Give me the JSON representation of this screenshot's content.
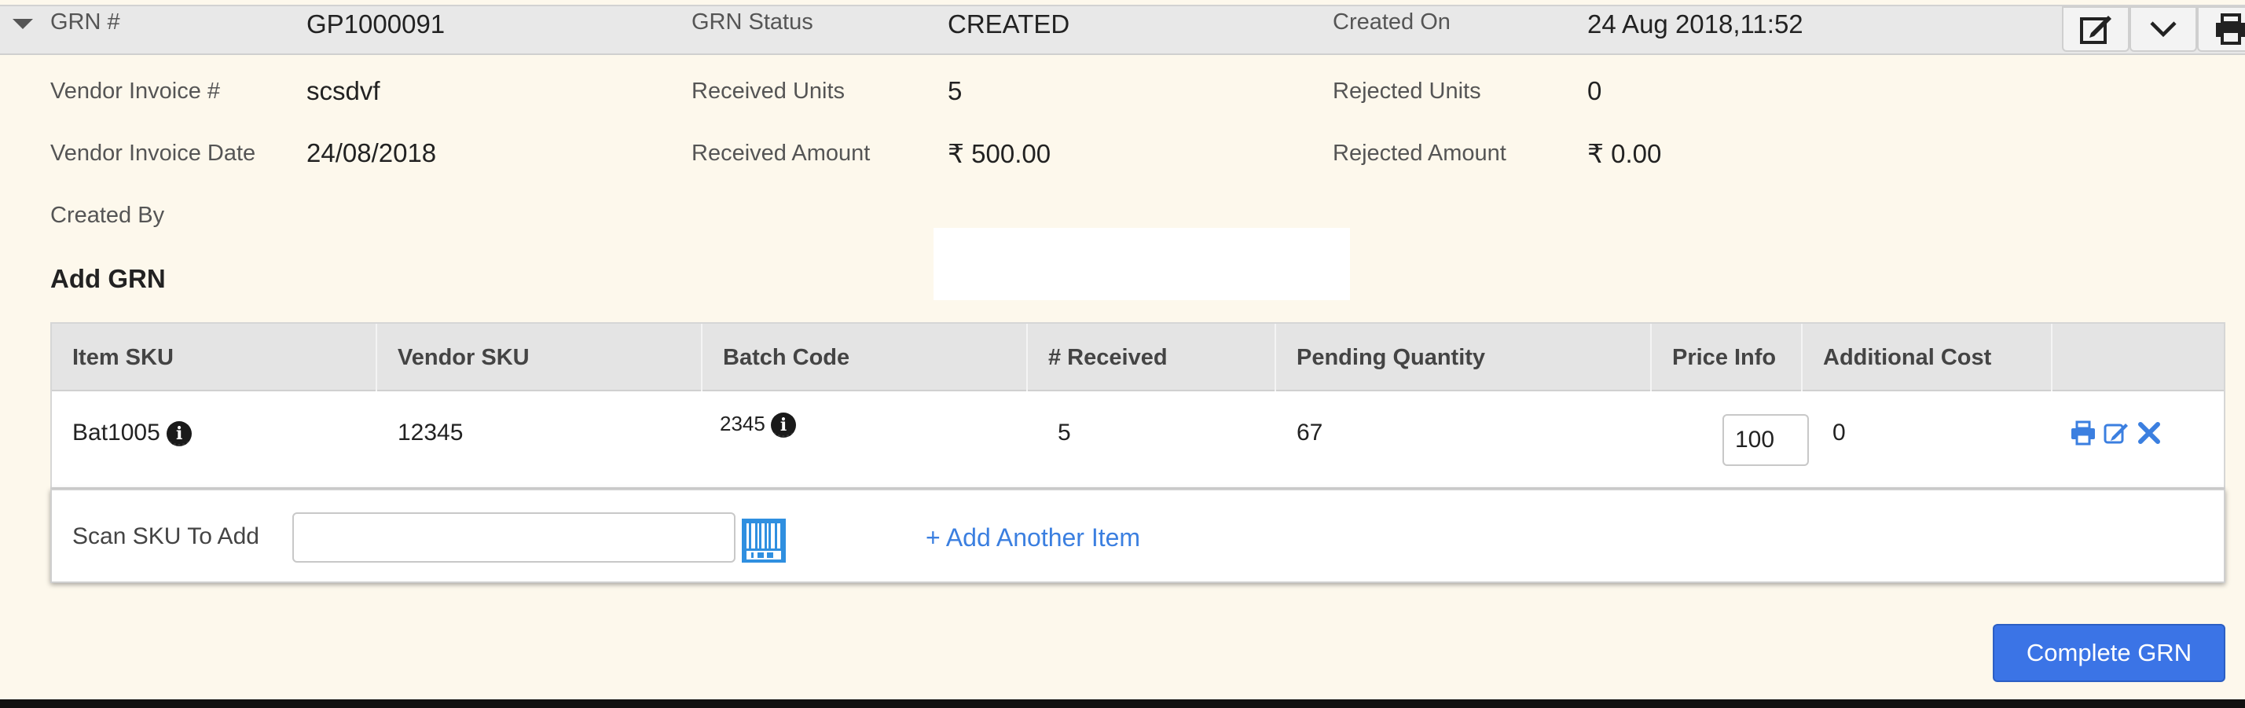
{
  "header": {
    "grn_label": "GRN #",
    "grn_value": "GP1000091",
    "status_label": "GRN Status",
    "status_value": "CREATED",
    "created_on_label": "Created On",
    "created_on_value": "24 Aug 2018,11:52"
  },
  "details": {
    "vendor_invoice_label": "Vendor Invoice #",
    "vendor_invoice_value": "scsdvf",
    "received_units_label": "Received Units",
    "received_units_value": "5",
    "rejected_units_label": "Rejected Units",
    "rejected_units_value": "0",
    "vendor_invoice_date_label": "Vendor Invoice Date",
    "vendor_invoice_date_value": "24/08/2018",
    "received_amount_label": "Received Amount",
    "received_amount_value": "₹ 500.00",
    "rejected_amount_label": "Rejected Amount",
    "rejected_amount_value": "₹ 0.00",
    "created_by_label": "Created By"
  },
  "section_title": "Add GRN",
  "table": {
    "columns": [
      "Item SKU",
      "Vendor SKU",
      "Batch Code",
      "# Received",
      "Pending Quantity",
      "Price Info",
      "Additional Cost"
    ],
    "row": {
      "item_sku": "Bat1005",
      "vendor_sku": "12345",
      "batch_code": "2345",
      "received": "5",
      "pending_quantity": "67",
      "price_info": "100",
      "additional_cost": "0"
    }
  },
  "scan": {
    "label": "Scan SKU To Add",
    "placeholder": "",
    "add_another": "+ Add Another Item"
  },
  "complete_button": "Complete GRN",
  "colors": {
    "accent": "#3b74e6",
    "link": "#3b7fe0",
    "background": "#fdf8ec",
    "header": "#e8e8e8"
  },
  "icons": {
    "info": "info-icon",
    "print": "print-icon",
    "edit": "edit-icon",
    "delete": "close-icon",
    "barcode": "barcode-icon",
    "caret": "caret-down-icon"
  }
}
